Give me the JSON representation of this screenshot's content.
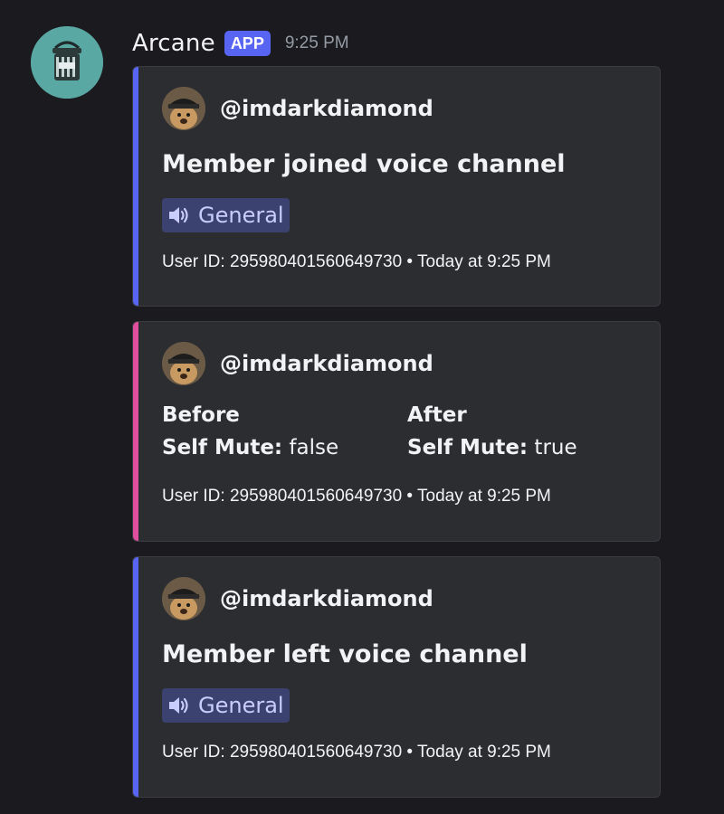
{
  "message": {
    "bot_name": "Arcane",
    "badge": "APP",
    "timestamp": "9:25 PM"
  },
  "colors": {
    "join_stripe": "#5865f2",
    "update_stripe": "#e04e9e",
    "leave_stripe": "#5865f2",
    "background": "#1b1b1f",
    "embed_bg": "#2b2d31",
    "mention_bg": "#3c4270",
    "mention_text": "#c9cdfb",
    "app_badge": "#5865f2"
  },
  "embeds": [
    {
      "author": "@imdarkdiamond",
      "title": "Member joined voice channel",
      "channel": "General",
      "channel_icon": "speaker-icon",
      "footer": "User ID: 295980401560649730 • Today at 9:25 PM"
    },
    {
      "author": "@imdarkdiamond",
      "before_label": "Before",
      "after_label": "After",
      "before_key": "Self Mute:",
      "before_value": " false",
      "after_key": "Self Mute:",
      "after_value": " true",
      "footer": "User ID: 295980401560649730 • Today at 9:25 PM"
    },
    {
      "author": "@imdarkdiamond",
      "title": "Member left voice channel",
      "channel": "General",
      "channel_icon": "speaker-icon",
      "footer": "User ID: 295980401560649730 • Today at 9:25 PM"
    }
  ]
}
